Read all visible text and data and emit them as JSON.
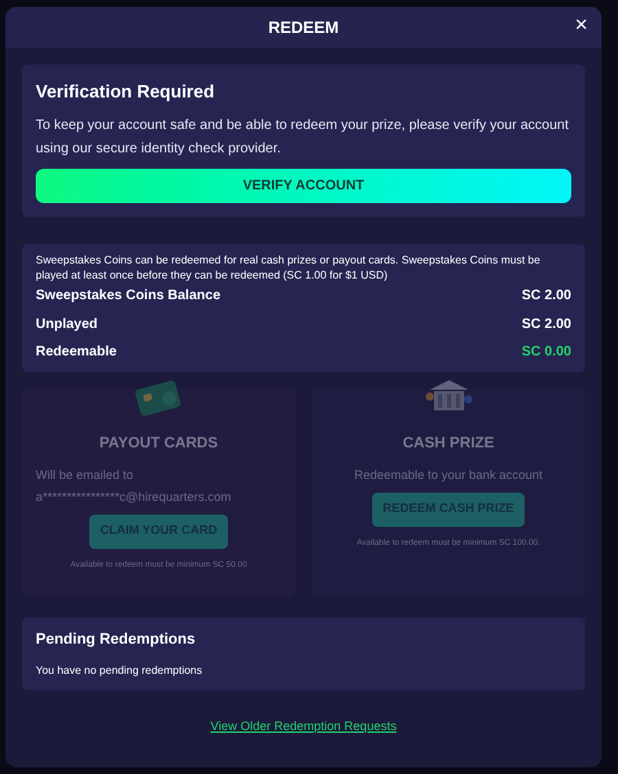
{
  "dialog": {
    "title": "REDEEM",
    "close": "×"
  },
  "verification": {
    "title": "Verification Required",
    "text": "To keep your account safe and be able to redeem your prize, please verify your account using our secure identity check provider.",
    "button": "VERIFY ACCOUNT"
  },
  "balance": {
    "note": "Sweepstakes Coins can be redeemed for real cash prizes or payout cards. Sweepstakes Coins must be played at least once before they can be redeemed (SC 1.00 for $1 USD)",
    "rows": [
      {
        "label": "Sweepstakes Coins Balance",
        "value": "SC 2.00",
        "highlight": false
      },
      {
        "label": "Unplayed",
        "value": "SC 2.00",
        "highlight": false
      },
      {
        "label": "Redeemable",
        "value": "SC 0.00",
        "highlight": true
      }
    ]
  },
  "options": [
    {
      "kind": "card",
      "title": "PAYOUT CARDS",
      "lines": [
        "Will be emailed to",
        "a****************c@hirequarters.com"
      ],
      "button": "CLAIM YOUR CARD",
      "note": "Available to redeem must be minimum SC 50.00",
      "disabled": true
    },
    {
      "kind": "bank",
      "title": "CASH PRIZE",
      "lines": [
        "Redeemable to your bank account"
      ],
      "button": "REDEEM CASH PRIZE",
      "note": "Available to redeem must be minimum SC 100.00.",
      "disabled": true
    }
  ],
  "pending": {
    "title": "Pending Redemptions",
    "text": "You have no pending redemptions"
  },
  "link": "View Older Redemption Requests"
}
